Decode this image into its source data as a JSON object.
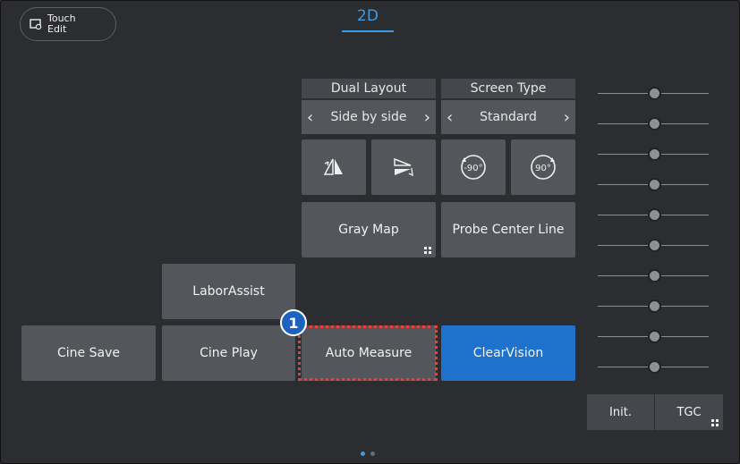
{
  "header": {
    "touch_edit_label": "Touch\nEdit",
    "active_tab": "2D"
  },
  "dual_layout": {
    "label": "Dual Layout",
    "value": "Side by side",
    "prev": "‹",
    "next": "›"
  },
  "screen_type": {
    "label": "Screen Type",
    "value": "Standard",
    "prev": "‹",
    "next": "›"
  },
  "rotate_buttons": [
    {
      "name": "flip-left-right",
      "text": ""
    },
    {
      "name": "flip-up-down",
      "text": ""
    },
    {
      "name": "rotate-minus-90",
      "text": "-90°"
    },
    {
      "name": "rotate-plus-90",
      "text": "90°"
    }
  ],
  "buttons": {
    "gray_map": "Gray Map",
    "probe_center_line": "Probe Center Line",
    "labor_assist": "LaborAssist",
    "cine_save": "Cine Save",
    "cine_play": "Cine Play",
    "auto_measure": "Auto Measure",
    "clear_vision": "ClearVision",
    "init": "Init.",
    "tgc": "TGC"
  },
  "callout_number": "1",
  "tgc_slider_count": 10,
  "colors": {
    "accent": "#3d9be9",
    "button": "#53565b",
    "highlight": "#e2433e",
    "active_button": "#1f72cc"
  },
  "pager": {
    "count": 2,
    "active": 0
  }
}
